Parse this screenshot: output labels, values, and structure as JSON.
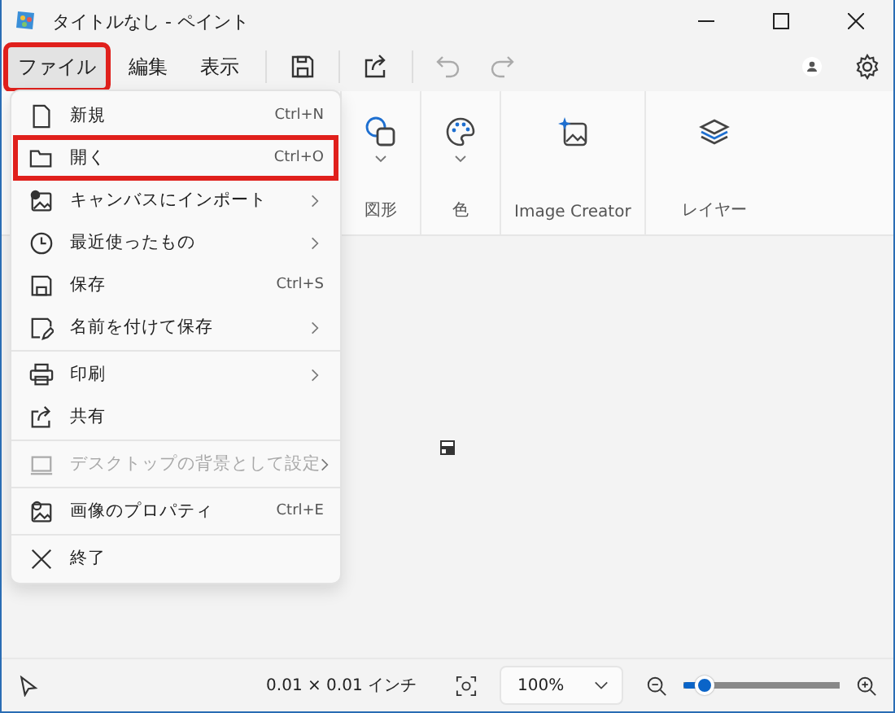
{
  "window": {
    "title": "タイトルなし - ペイント"
  },
  "menu_bar": [
    {
      "label": "ファイル",
      "selected": true,
      "highlighted": true
    },
    {
      "label": "編集",
      "selected": false,
      "highlighted": false
    },
    {
      "label": "表示",
      "selected": false,
      "highlighted": false
    }
  ],
  "ribbon": [
    {
      "kind": "shapes",
      "label": "図形",
      "dropdown": true
    },
    {
      "kind": "color",
      "label": "色",
      "dropdown": true
    },
    {
      "kind": "creator",
      "label": "Image Creator",
      "dropdown": false
    },
    {
      "kind": "layers",
      "label": "レイヤー",
      "dropdown": false
    }
  ],
  "file_menu": [
    {
      "kind": "new",
      "label": "新規",
      "shortcut": "Ctrl+N",
      "submenu": false,
      "disabled": false,
      "highlighted": false,
      "divider_after": false
    },
    {
      "kind": "open",
      "label": "開く",
      "shortcut": "Ctrl+O",
      "submenu": false,
      "disabled": false,
      "highlighted": true,
      "divider_after": false
    },
    {
      "kind": "import",
      "label": "キャンバスにインポート",
      "submenu": true,
      "disabled": false,
      "highlighted": false,
      "divider_after": false
    },
    {
      "kind": "recent",
      "label": "最近使ったもの",
      "submenu": true,
      "disabled": false,
      "highlighted": false,
      "divider_after": false
    },
    {
      "kind": "save",
      "label": "保存",
      "shortcut": "Ctrl+S",
      "submenu": false,
      "disabled": false,
      "highlighted": false,
      "divider_after": false
    },
    {
      "kind": "saveas",
      "label": "名前を付けて保存",
      "submenu": true,
      "disabled": false,
      "highlighted": false,
      "divider_after": true
    },
    {
      "kind": "print",
      "label": "印刷",
      "submenu": true,
      "disabled": false,
      "highlighted": false,
      "divider_after": false
    },
    {
      "kind": "share",
      "label": "共有",
      "submenu": false,
      "disabled": false,
      "highlighted": false,
      "divider_after": true
    },
    {
      "kind": "desktop",
      "label": "デスクトップの背景として設定",
      "submenu": true,
      "disabled": true,
      "highlighted": false,
      "divider_after": true
    },
    {
      "kind": "properties",
      "label": "画像のプロパティ",
      "shortcut": "Ctrl+E",
      "submenu": false,
      "disabled": false,
      "highlighted": false,
      "divider_after": true
    },
    {
      "kind": "exit",
      "label": "終了",
      "submenu": false,
      "disabled": false,
      "highlighted": false,
      "divider_after": false
    }
  ],
  "status_bar": {
    "canvas_size": "0.01 × 0.01 インチ",
    "zoom": "100%",
    "zoom_slider": {
      "level": 0.14
    }
  }
}
